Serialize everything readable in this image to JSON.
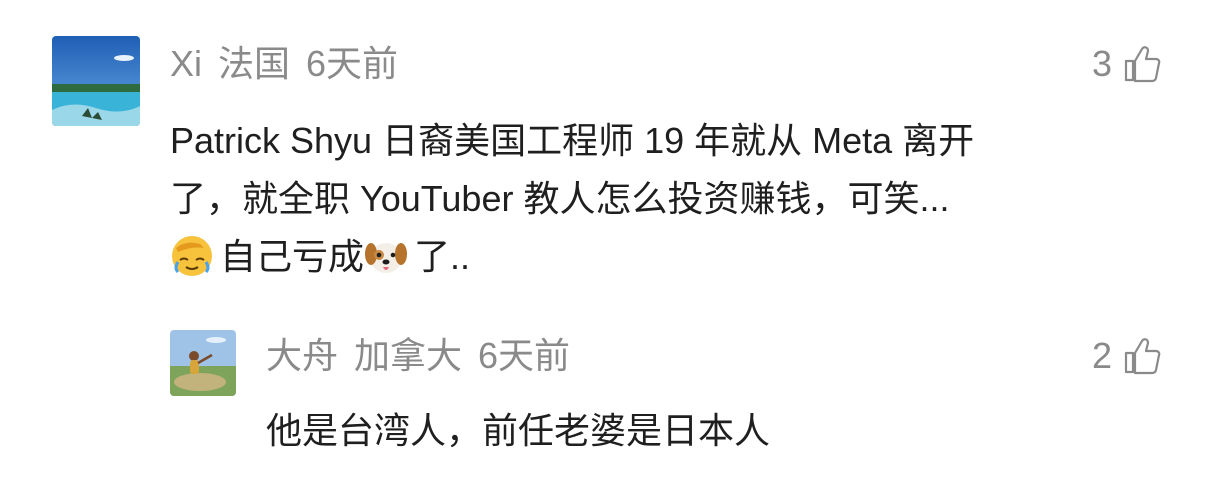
{
  "comments": [
    {
      "user": "Xi",
      "location": "法国",
      "time": "6天前",
      "likes": "3",
      "text_line1": "Patrick Shyu 日裔美国工程师 19 年就从 Meta 离开",
      "text_line2": "了，就全职 YouTuber 教人怎么投资赚钱，可笑...",
      "text_line3a": "自己亏成",
      "text_line3b": "了..",
      "emoji1": "face-palm-crying-emoji",
      "emoji2": "dog-face-emoji"
    },
    {
      "user": "大舟",
      "location": "加拿大",
      "time": "6天前",
      "likes": "2",
      "text": "他是台湾人，前任老婆是日本人"
    }
  ],
  "icons": {
    "like": "thumbs-up-outline-icon"
  },
  "colors": {
    "meta_text": "#8a8a8a",
    "body_text": "#1f1f1f",
    "emoji_yellow": "#f7c23c"
  }
}
